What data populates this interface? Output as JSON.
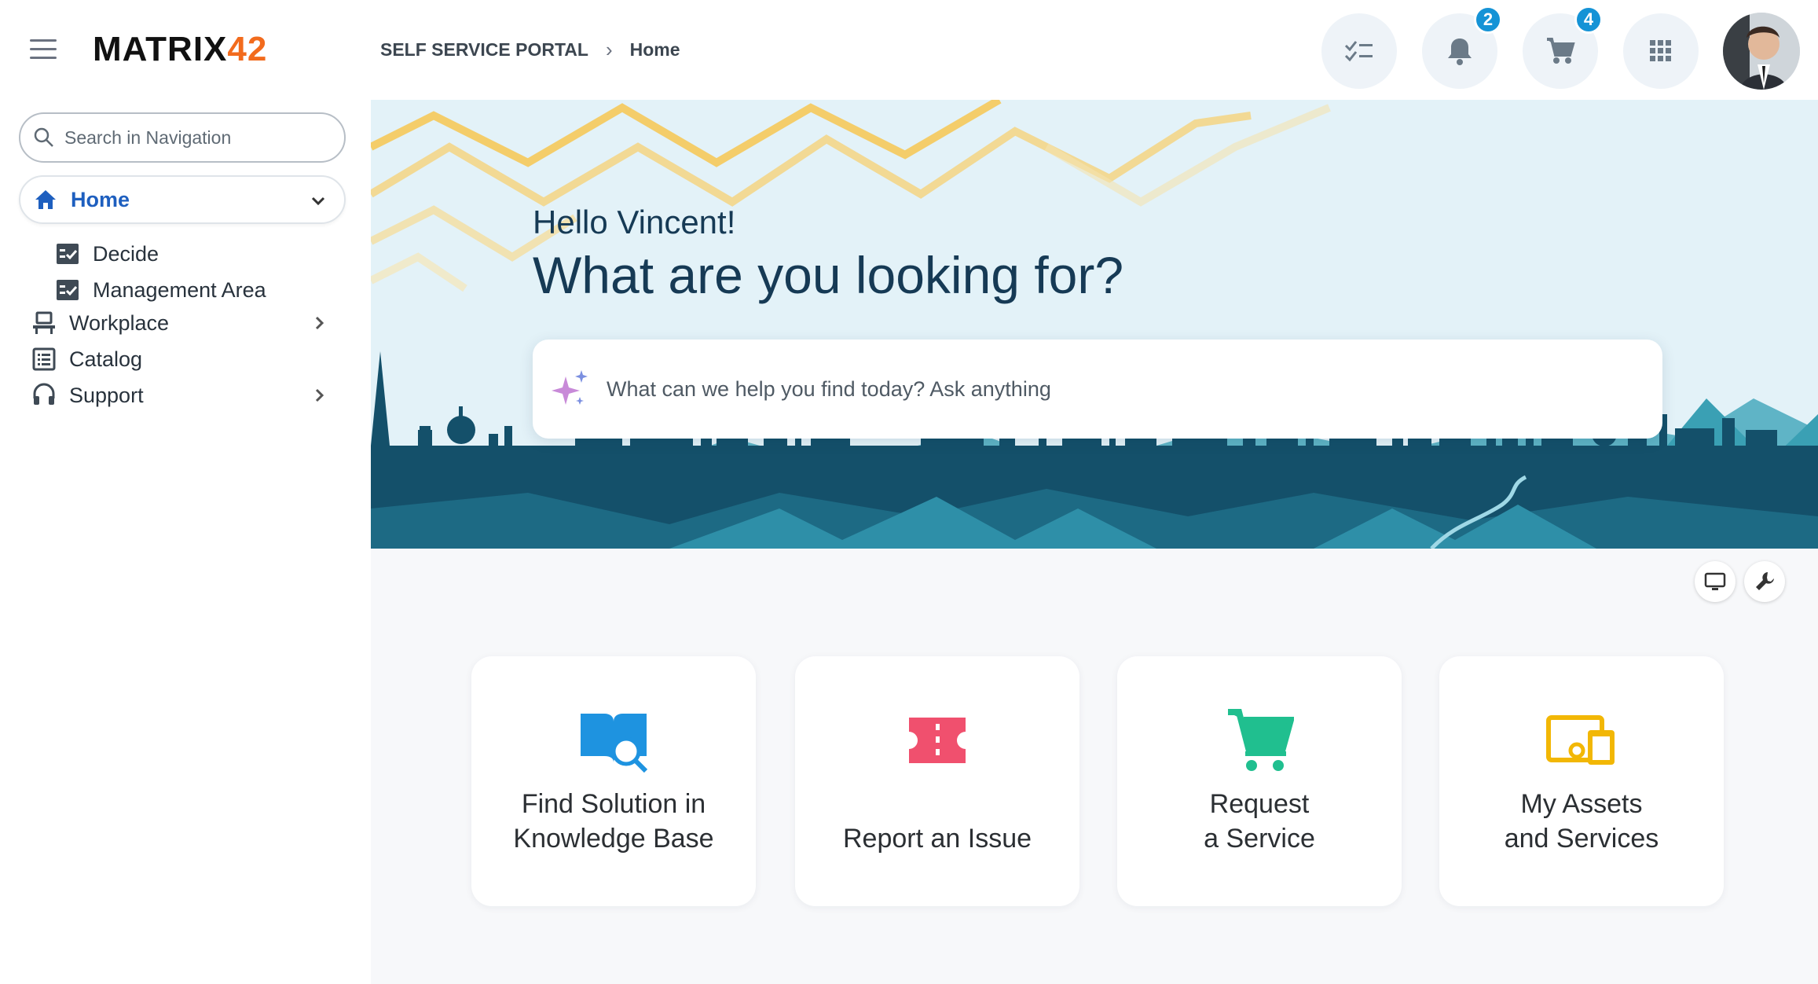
{
  "header": {
    "logo_main": "MATRIX",
    "logo_num": "42",
    "breadcrumb": [
      "SELF SERVICE PORTAL",
      "Home"
    ],
    "notifications_count": "2",
    "cart_count": "4"
  },
  "sidebar": {
    "search_placeholder": "Search in Navigation",
    "items": [
      {
        "label": "Home"
      },
      {
        "label": "Decide"
      },
      {
        "label": "Management Area"
      },
      {
        "label": "Workplace"
      },
      {
        "label": "Catalog"
      },
      {
        "label": "Support"
      }
    ]
  },
  "hero": {
    "greeting": "Hello Vincent!",
    "question": "What are you looking for?",
    "ask_placeholder": "What can we help you find today? Ask anything"
  },
  "tiles": [
    {
      "line1": "Find Solution in",
      "line2": "Knowledge Base",
      "icon": "book-search-icon",
      "color": "#1e93e0"
    },
    {
      "line1": "",
      "line2": "Report an Issue",
      "icon": "ticket-icon",
      "color": "#f0506e"
    },
    {
      "line1": "Request",
      "line2": "a Service",
      "icon": "cart-icon",
      "color": "#20bf8f"
    },
    {
      "line1": "My Assets",
      "line2": "and Services",
      "icon": "devices-icon",
      "color": "#f2b705"
    }
  ],
  "colors": {
    "accent": "#1e5fbf",
    "badge": "#1593d6",
    "logo_orange": "#f26b1d",
    "hero_bg": "#e3f2f8",
    "skyline": "#14506a"
  }
}
